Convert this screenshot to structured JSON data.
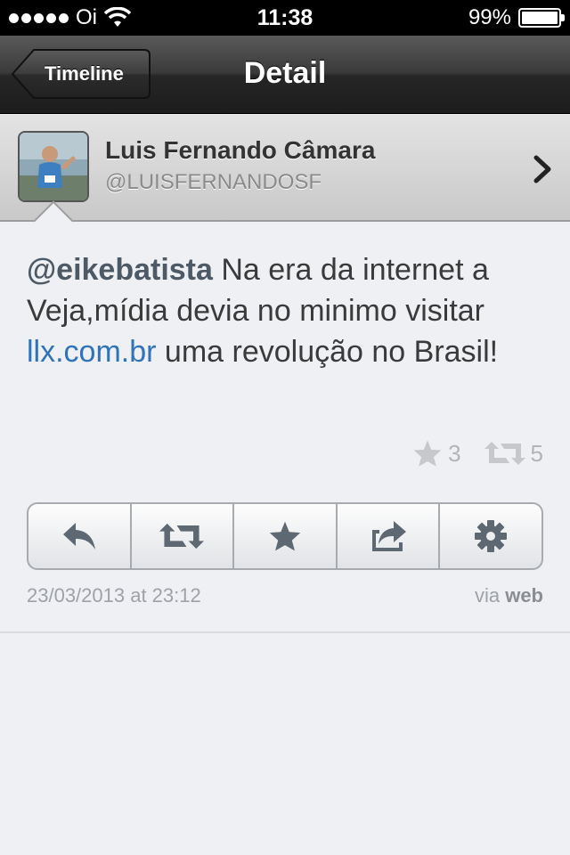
{
  "status_bar": {
    "carrier": "Oi",
    "time": "11:38",
    "battery": "99%",
    "battery_level": 0.99
  },
  "nav": {
    "back_label": "Timeline",
    "title": "Detail"
  },
  "profile": {
    "name": "Luis Fernando Câmara",
    "handle": "@LUISFERNANDOSF"
  },
  "tweet": {
    "mention": "@eikebatista",
    "text_part1": " Na era da internet a Veja,mídia devia no minimo visitar ",
    "link": "llx.com.br",
    "text_part2": " uma revolução no Brasil!"
  },
  "counts": {
    "favorites": "3",
    "retweets": "5"
  },
  "actions": [
    {
      "name": "reply",
      "icon": "reply-icon"
    },
    {
      "name": "retweet",
      "icon": "retweet-icon"
    },
    {
      "name": "favorite",
      "icon": "star-icon"
    },
    {
      "name": "share",
      "icon": "share-icon"
    },
    {
      "name": "settings",
      "icon": "gear-icon"
    }
  ],
  "meta": {
    "date": "23/03/2013 at 23:12",
    "via_prefix": "via",
    "via_source": "web"
  },
  "colors": {
    "link": "#2f73b8",
    "mention": "#4d5a66",
    "nav_bar": "#2a2a2a",
    "icon": "#5e6873"
  }
}
